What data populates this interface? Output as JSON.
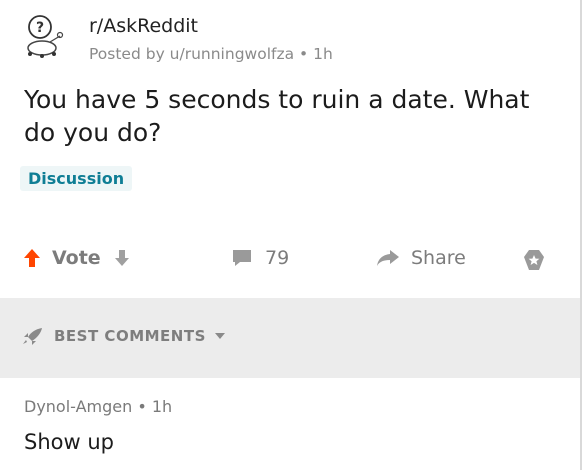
{
  "post": {
    "subreddit": "r/AskReddit",
    "meta": "Posted by u/runningwolfza • 1h",
    "title": "You have 5 seconds to ruin a date. What do you do?",
    "flair": "Discussion",
    "avatar_icon": "askreddit-mascot-icon"
  },
  "actions": {
    "vote_label": "Vote",
    "comments_count": "79",
    "share_label": "Share",
    "upvote_color": "#ff4500"
  },
  "comments_section": {
    "sort_label": "BEST COMMENTS"
  },
  "comment": {
    "meta": "Dynol-Amgen • 1h",
    "body": "Show up"
  }
}
